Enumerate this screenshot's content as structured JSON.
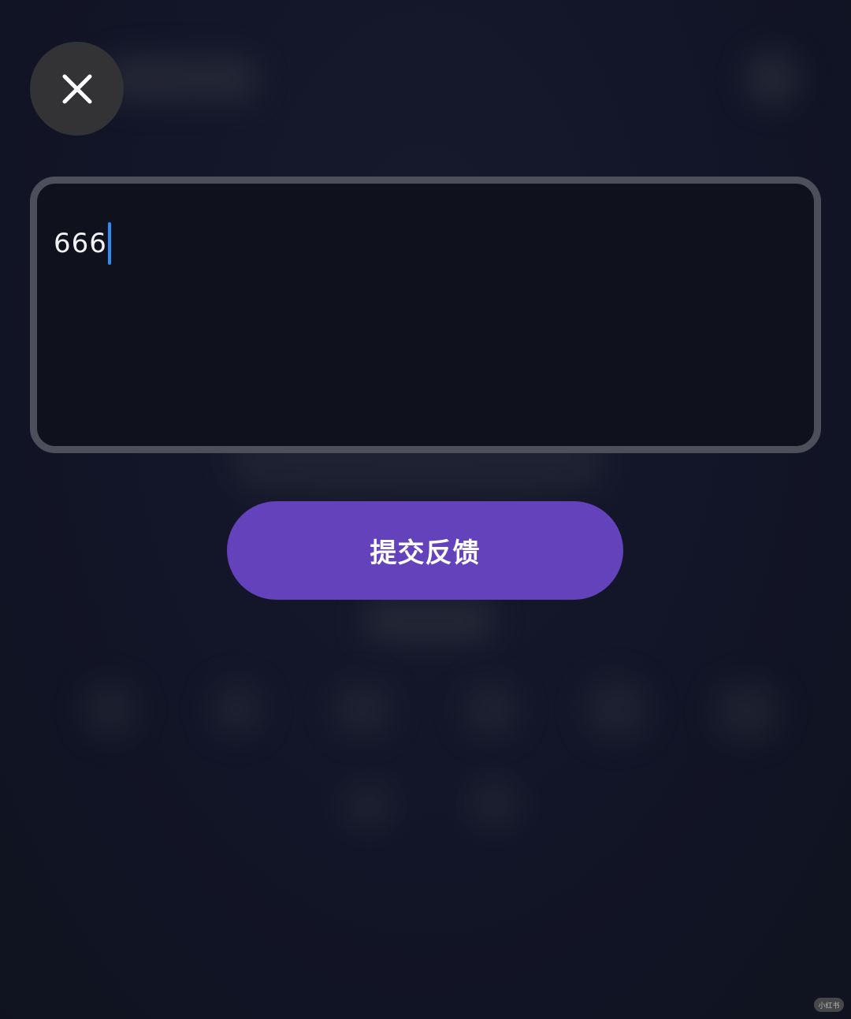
{
  "close_button": {
    "icon": "close-icon"
  },
  "feedback": {
    "value": "666"
  },
  "submit": {
    "label": "提交反馈",
    "color": "#6442bb"
  },
  "watermark": {
    "text": "小红书"
  }
}
